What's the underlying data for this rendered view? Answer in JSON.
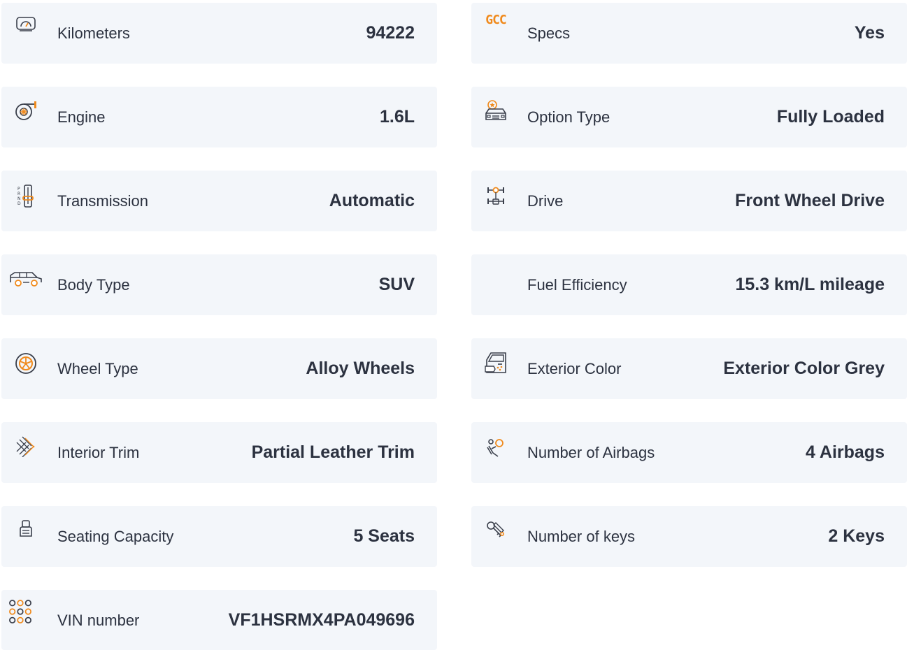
{
  "colors": {
    "card_bg": "#f3f6fa",
    "text": "#2c3240",
    "accent": "#f08a1c",
    "icon_stroke": "#3a3f4b"
  },
  "left": [
    {
      "icon": "speedometer-icon",
      "label": "Kilometers",
      "value": "94222"
    },
    {
      "icon": "turbo-engine-icon",
      "label": "Engine",
      "value": "1.6L"
    },
    {
      "icon": "gear-shifter-icon",
      "label": "Transmission",
      "value": "Automatic"
    },
    {
      "icon": "suv-car-icon",
      "label": "Body Type",
      "value": "SUV"
    },
    {
      "icon": "alloy-wheel-icon",
      "label": "Wheel Type",
      "value": "Alloy Wheels"
    },
    {
      "icon": "leather-texture-icon",
      "label": "Interior Trim",
      "value": "Partial Leather Trim"
    },
    {
      "icon": "car-seat-icon",
      "label": "Seating Capacity",
      "value": "5 Seats"
    },
    {
      "icon": "vin-dots-icon",
      "label": "VIN number",
      "value": "VF1HSRMX4PA049696"
    }
  ],
  "right": [
    {
      "icon": "gcc-icon",
      "icon_text": "GCC",
      "label": "Specs",
      "value": "Yes"
    },
    {
      "icon": "car-star-icon",
      "label": "Option Type",
      "value": "Fully Loaded"
    },
    {
      "icon": "drivetrain-icon",
      "label": "Drive",
      "value": "Front Wheel Drive"
    },
    {
      "icon": "",
      "label": "Fuel Efficiency",
      "value": "15.3 km/L mileage"
    },
    {
      "icon": "car-door-paint-icon",
      "label": "Exterior Color",
      "value": "Exterior Color Grey"
    },
    {
      "icon": "airbag-icon",
      "label": "Number of Airbags",
      "value": "4 Airbags"
    },
    {
      "icon": "car-keys-icon",
      "label": "Number of keys",
      "value": "2 Keys"
    }
  ]
}
